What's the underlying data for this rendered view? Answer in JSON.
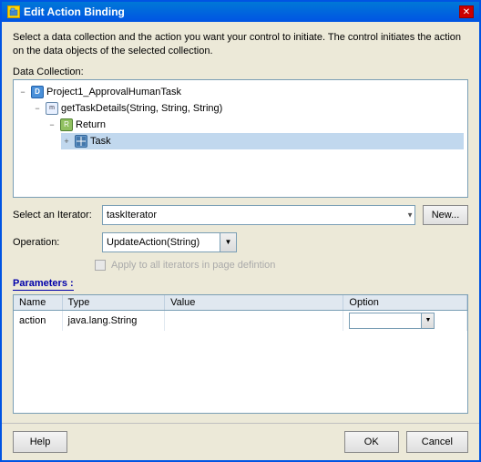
{
  "window": {
    "title": "Edit Action Binding",
    "close_label": "✕"
  },
  "description": "Select a data collection and the action you want your control to initiate. The control initiates the action on the data objects of the selected collection.",
  "sections": {
    "data_collection_label": "Data Collection:",
    "iterator_label": "Select an Iterator:",
    "operation_label": "Operation:",
    "parameters_label": "Parameters :"
  },
  "tree": {
    "nodes": [
      {
        "id": "n1",
        "indent": 1,
        "expand": "−",
        "icon": "db",
        "label": "Project1_ApprovalHumanTask",
        "selected": false
      },
      {
        "id": "n2",
        "indent": 2,
        "expand": "−",
        "icon": "method",
        "label": "getTaskDetails(String, String, String)",
        "selected": false
      },
      {
        "id": "n3",
        "indent": 3,
        "expand": "−",
        "icon": "return",
        "label": "Return",
        "selected": false
      },
      {
        "id": "n4",
        "indent": 4,
        "expand": "+",
        "icon": "table",
        "label": "Task",
        "selected": true
      }
    ]
  },
  "iterator": {
    "selected": "taskIterator",
    "options": [
      "taskIterator"
    ],
    "new_button_label": "New..."
  },
  "operation": {
    "selected": "UpdateAction(String)",
    "options": [
      "UpdateAction(String)"
    ]
  },
  "checkbox": {
    "label": "Apply to all iterators in page defintion",
    "checked": false,
    "disabled": true
  },
  "parameters_table": {
    "columns": [
      "Name",
      "Type",
      "Value",
      "Option"
    ],
    "rows": [
      {
        "name": "action",
        "type": "java.lang.String",
        "value": "",
        "option": ""
      }
    ]
  },
  "footer": {
    "help_label": "Help",
    "ok_label": "OK",
    "cancel_label": "Cancel"
  }
}
